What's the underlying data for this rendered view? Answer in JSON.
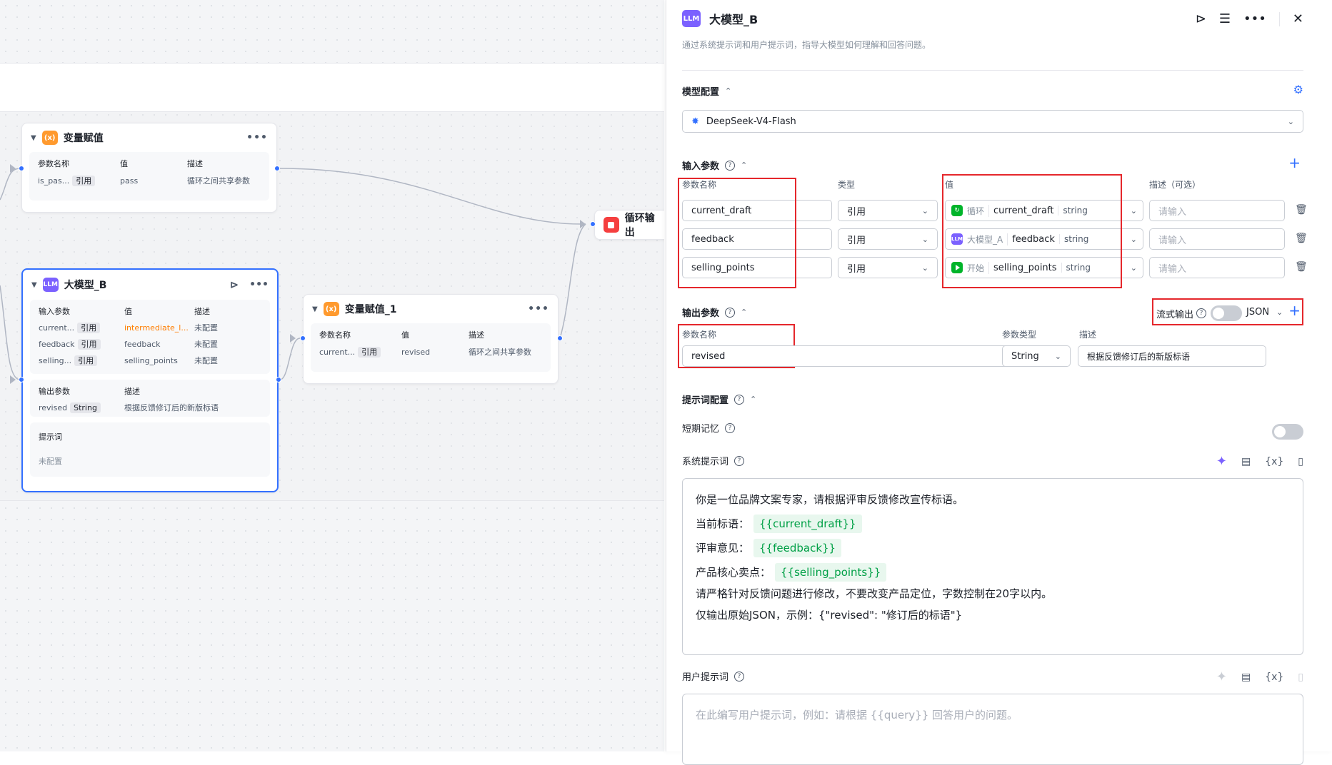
{
  "canvas": {
    "nodes": {
      "var_assign": {
        "title": "变量赋值",
        "badge": "(x)",
        "col_name": "参数名称",
        "col_value": "值",
        "col_desc": "描述",
        "row": {
          "name": "is_pas...",
          "ref": "引用",
          "value": "pass",
          "desc": "循环之间共享参数"
        }
      },
      "loop_output": {
        "title": "循环输出"
      },
      "llm_b": {
        "title": "大模型_B",
        "badge": "LLM",
        "in_label": "输入参数",
        "col_value": "值",
        "col_desc": "描述",
        "inputs": [
          {
            "name": "current...",
            "ref": "引用",
            "value": "intermediate_l...",
            "desc": "未配置"
          },
          {
            "name": "feedback",
            "ref": "引用",
            "value": "feedback",
            "desc": "未配置"
          },
          {
            "name": "selling...",
            "ref": "引用",
            "value": "selling_points",
            "desc": "未配置"
          }
        ],
        "out_label": "输出参数",
        "out_desc_label": "描述",
        "output": {
          "name": "revised",
          "type": "String",
          "desc": "根据反馈修订后的新版标语"
        },
        "prompt_label": "提示词",
        "prompt_value": "未配置"
      },
      "var_assign_1": {
        "title": "变量赋值_1",
        "badge": "(x)",
        "col_name": "参数名称",
        "col_value": "值",
        "col_desc": "描述",
        "row": {
          "name": "current...",
          "ref": "引用",
          "value": "revised",
          "desc": "循环之间共享参数"
        }
      }
    }
  },
  "panel": {
    "badge": "LLM",
    "title": "大模型_B",
    "description": "通过系统提示词和用户提示词，指导大模型如何理解和回答问题。",
    "model_section": "模型配置",
    "model_name": "DeepSeek-V4-Flash",
    "input_section": "输入参数",
    "input_headers": {
      "name": "参数名称",
      "type": "类型",
      "value": "值",
      "desc": "描述（可选）"
    },
    "inputs": [
      {
        "name": "current_draft",
        "type": "引用",
        "source": "循环",
        "source_icon": "loop-icon",
        "var": "current_draft",
        "var_type": "string",
        "desc_placeholder": "请输入"
      },
      {
        "name": "feedback",
        "type": "引用",
        "source": "大模型_A",
        "source_icon": "llm-icon",
        "var": "feedback",
        "var_type": "string",
        "desc_placeholder": "请输入"
      },
      {
        "name": "selling_points",
        "type": "引用",
        "source": "开始",
        "source_icon": "start-icon",
        "var": "selling_points",
        "var_type": "string",
        "desc_placeholder": "请输入"
      }
    ],
    "output_section": "输出参数",
    "stream_label": "流式输出",
    "format": "JSON",
    "output_headers": {
      "name": "参数名称",
      "type": "参数类型",
      "desc": "描述"
    },
    "output": {
      "name": "revised",
      "type": "String",
      "desc": "根据反馈修订后的新版标语"
    },
    "prompt_section": "提示词配置",
    "short_memory": "短期记忆",
    "system_prompt_label": "系统提示词",
    "system_prompt": {
      "line1": "你是一位品牌文案专家，请根据评审反馈修改宣传标语。",
      "line2_label": "当前标语：",
      "line2_var": "{{current_draft}}",
      "line3_label": "评审意见：",
      "line3_var": "{{feedback}}",
      "line4_label": "产品核心卖点：",
      "line4_var": "{{selling_points}}",
      "line5": "请严格针对反馈问题进行修改，不要改变产品定位，字数控制在20字以内。",
      "line6": "仅输出原始JSON，示例：{\"revised\": \"修订后的标语\"}"
    },
    "user_prompt_label": "用户提示词",
    "user_prompt_placeholder": "在此编写用户提示词，例如：请根据 {{query}} 回答用户的问题。"
  },
  "colors": {
    "accent": "#3370ff",
    "highlight_red": "#e5272c",
    "var_green": "#00a046"
  }
}
